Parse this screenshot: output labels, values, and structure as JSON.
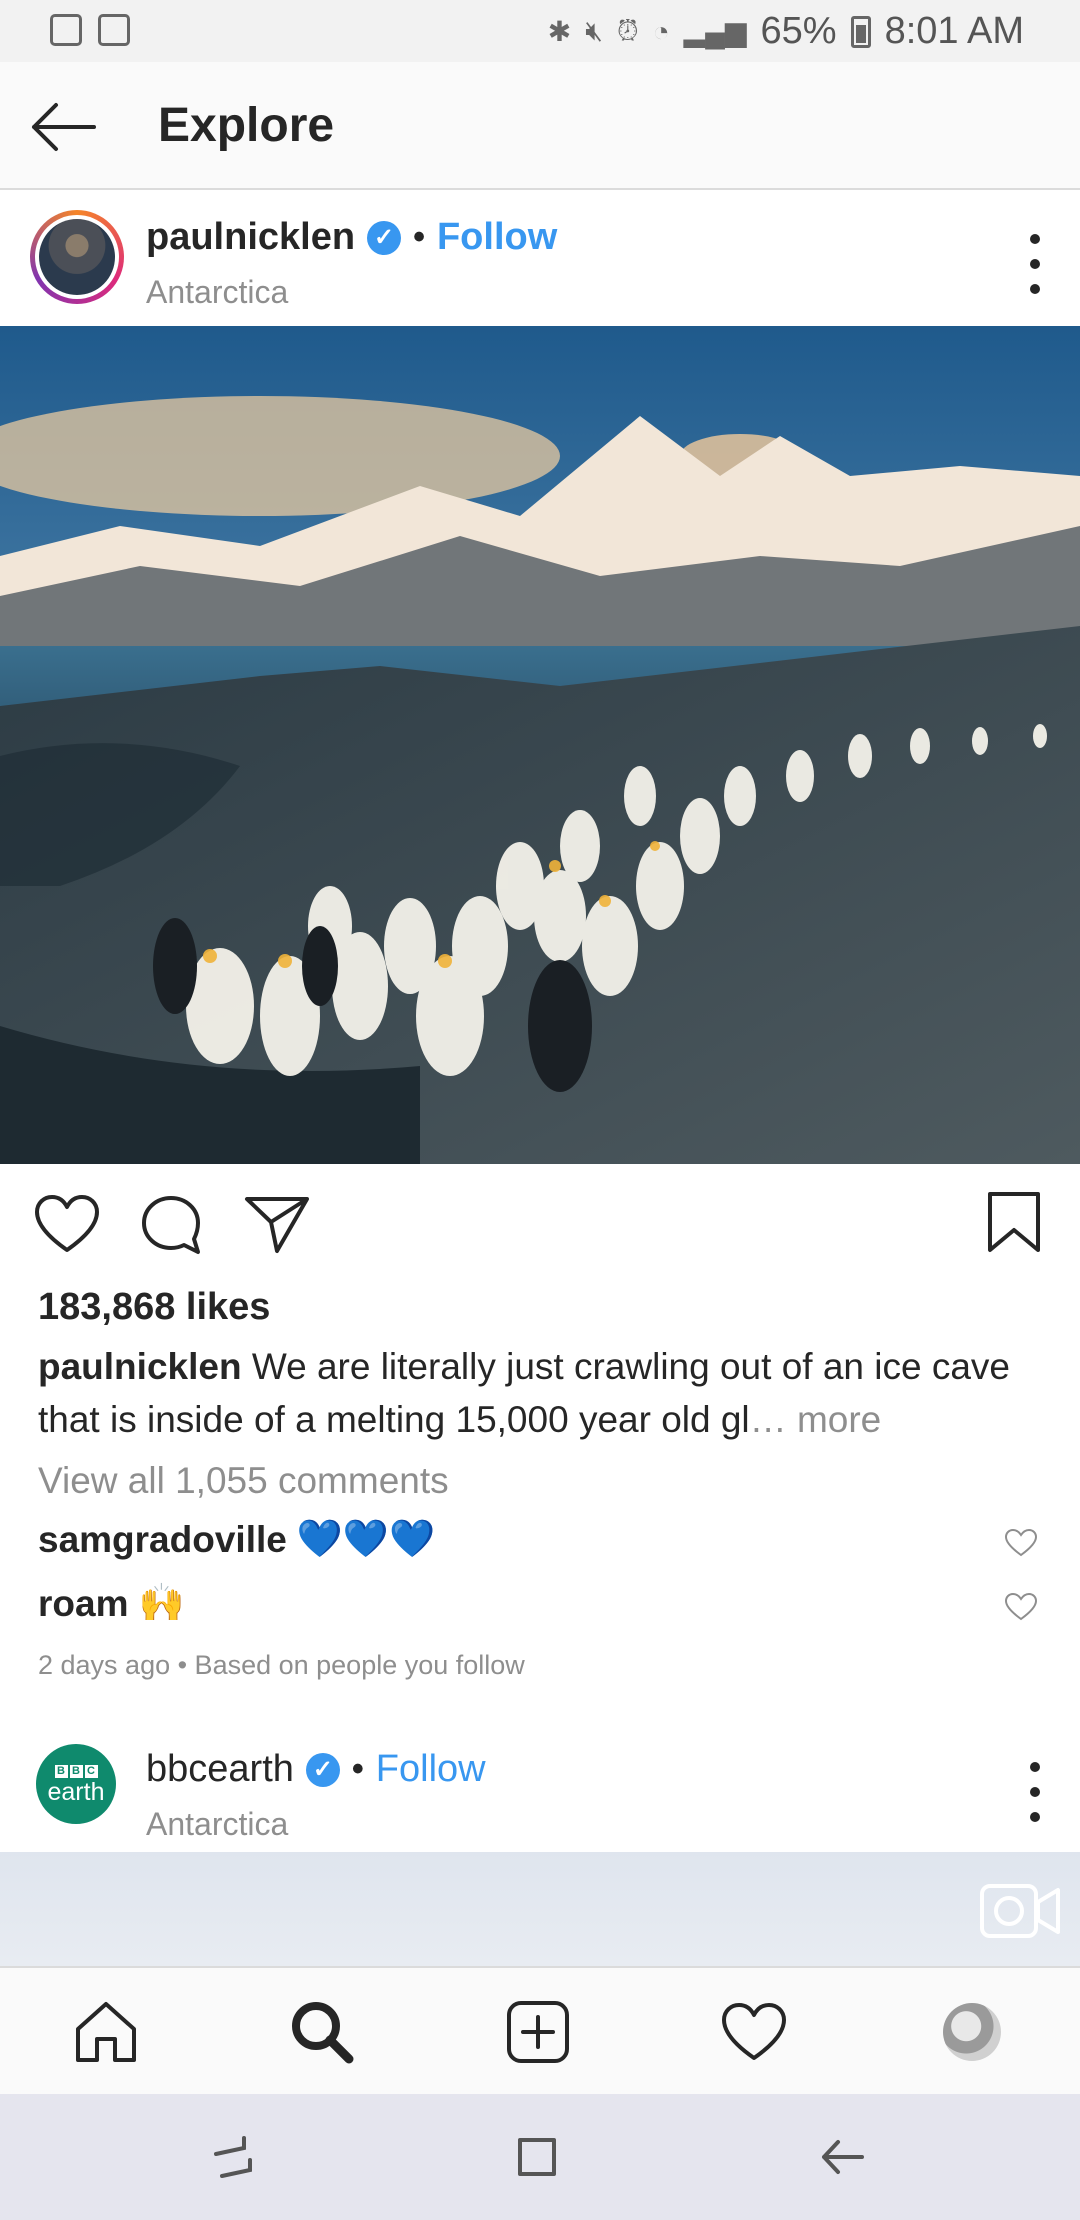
{
  "status_bar": {
    "battery": "65%",
    "time": "8:01 AM"
  },
  "header": {
    "title": "Explore"
  },
  "post1": {
    "username": "paulnicklen",
    "verified_mark": "✓",
    "separator": "•",
    "follow_label": "Follow",
    "location": "Antarctica",
    "likes": "183,868 likes",
    "caption_user": "paulnicklen",
    "caption_text": "We are literally just crawling out of an ice cave that is inside of a melting 15,000 year old gl",
    "caption_ellipsis": "…",
    "caption_more": "more",
    "view_comments": "View all 1,055 comments",
    "comments": [
      {
        "user": "samgradoville",
        "text": "💙💙💙"
      },
      {
        "user": "roam",
        "text": "🙌"
      }
    ],
    "meta": "2 days ago • Based on people you follow"
  },
  "post2": {
    "username": "bbcearth",
    "verified_mark": "✓",
    "separator": "•",
    "follow_label": "Follow",
    "location": "Antarctica",
    "avatar_letters": [
      "B",
      "B",
      "C"
    ],
    "avatar_word": "earth"
  },
  "colors": {
    "accent": "#3897f0",
    "text": "#262626",
    "muted": "#8e8e8e",
    "bbc_green": "#0f8a6d"
  },
  "icons": {
    "header": "back-arrow-icon",
    "actions": [
      "heart-icon",
      "comment-icon",
      "share-icon",
      "bookmark-icon"
    ],
    "bottom_nav": [
      "home-icon",
      "search-icon",
      "add-post-icon",
      "activity-heart-icon",
      "profile-avatar"
    ],
    "android": [
      "recent-apps-icon",
      "home-square-icon",
      "back-icon"
    ]
  }
}
